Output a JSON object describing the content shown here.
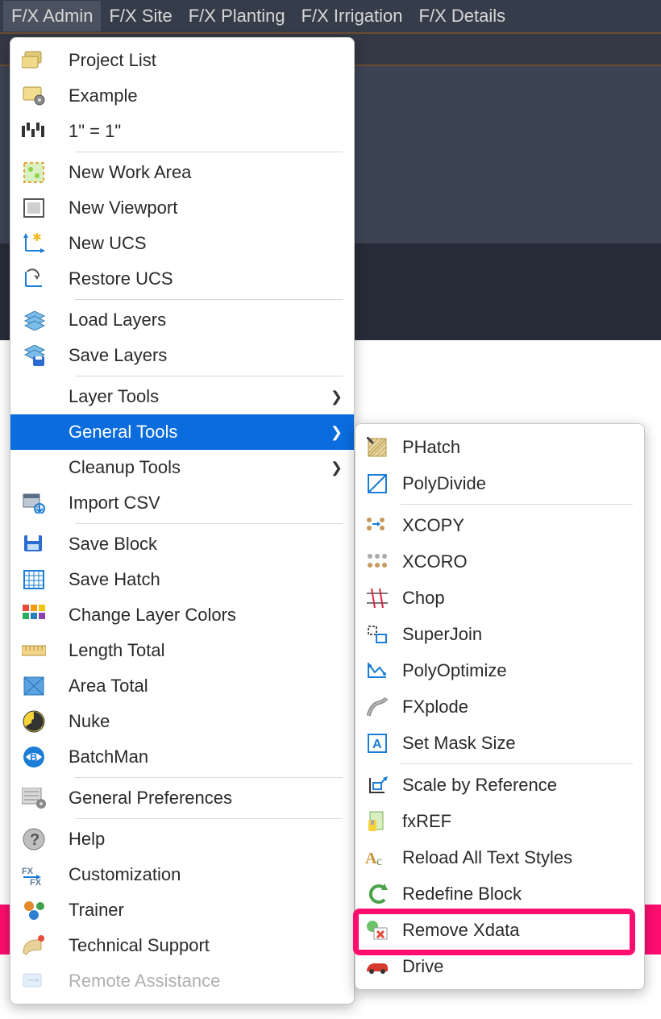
{
  "menubar": {
    "items": [
      {
        "label": "F/X Admin",
        "active": true
      },
      {
        "label": "F/X Site",
        "active": false
      },
      {
        "label": "F/X Planting",
        "active": false
      },
      {
        "label": "F/X Irrigation",
        "active": false
      },
      {
        "label": "F/X Details",
        "active": false
      }
    ]
  },
  "primary_menu": [
    {
      "label": "Project List",
      "icon": "folders-icon"
    },
    {
      "label": "Example",
      "icon": "folder-gear-icon"
    },
    {
      "label": "1\" = 1\"",
      "icon": "scale-icon"
    },
    {
      "sep": true
    },
    {
      "label": "New Work Area",
      "icon": "workarea-icon"
    },
    {
      "label": "New Viewport",
      "icon": "viewport-icon"
    },
    {
      "label": "New UCS",
      "icon": "new-ucs-icon"
    },
    {
      "label": "Restore UCS",
      "icon": "restore-ucs-icon"
    },
    {
      "sep": true
    },
    {
      "label": "Load Layers",
      "icon": "load-layers-icon"
    },
    {
      "label": "Save Layers",
      "icon": "save-layers-icon"
    },
    {
      "sep": true
    },
    {
      "label": "Layer Tools",
      "icon": "",
      "submenu": true
    },
    {
      "label": "General Tools",
      "icon": "",
      "submenu": true,
      "highlighted": true
    },
    {
      "label": "Cleanup Tools",
      "icon": "",
      "submenu": true
    },
    {
      "label": "Import CSV",
      "icon": "import-csv-icon"
    },
    {
      "sep": true
    },
    {
      "label": "Save Block",
      "icon": "save-block-icon"
    },
    {
      "label": "Save Hatch",
      "icon": "save-hatch-icon"
    },
    {
      "label": "Change Layer Colors",
      "icon": "swatches-icon"
    },
    {
      "label": "Length Total",
      "icon": "ruler-icon"
    },
    {
      "label": "Area Total",
      "icon": "area-icon"
    },
    {
      "label": "Nuke",
      "icon": "nuke-icon"
    },
    {
      "label": "BatchMan",
      "icon": "batchman-icon"
    },
    {
      "sep": true
    },
    {
      "label": "General Preferences",
      "icon": "prefs-icon"
    },
    {
      "sep": true
    },
    {
      "label": "Help",
      "icon": "help-icon"
    },
    {
      "label": "Customization",
      "icon": "fx-custom-icon"
    },
    {
      "label": "Trainer",
      "icon": "trainer-icon"
    },
    {
      "label": "Technical Support",
      "icon": "support-icon"
    },
    {
      "label": "Remote Assistance",
      "icon": "remote-icon",
      "faded": true
    }
  ],
  "secondary_menu": [
    {
      "label": "PHatch",
      "icon": "phatch-icon"
    },
    {
      "label": "PolyDivide",
      "icon": "polydivide-icon"
    },
    {
      "sep": true
    },
    {
      "label": "XCOPY",
      "icon": "xcopy-icon"
    },
    {
      "label": "XCORO",
      "icon": "xcoro-icon"
    },
    {
      "label": "Chop",
      "icon": "chop-icon"
    },
    {
      "label": "SuperJoin",
      "icon": "superjoin-icon"
    },
    {
      "label": "PolyOptimize",
      "icon": "polyopt-icon"
    },
    {
      "label": "FXplode",
      "icon": "fxplode-icon"
    },
    {
      "label": "Set Mask Size",
      "icon": "mask-icon"
    },
    {
      "sep": true
    },
    {
      "label": "Scale by Reference",
      "icon": "scale-ref-icon"
    },
    {
      "label": "fxREF",
      "icon": "fxref-icon"
    },
    {
      "label": "Reload All Text Styles",
      "icon": "textstyle-icon"
    },
    {
      "label": "Redefine Block",
      "icon": "redefine-icon"
    },
    {
      "label": "Remove Xdata",
      "icon": "remove-xdata-icon",
      "highlight_box": true
    },
    {
      "label": "Drive",
      "icon": "car-icon"
    }
  ]
}
